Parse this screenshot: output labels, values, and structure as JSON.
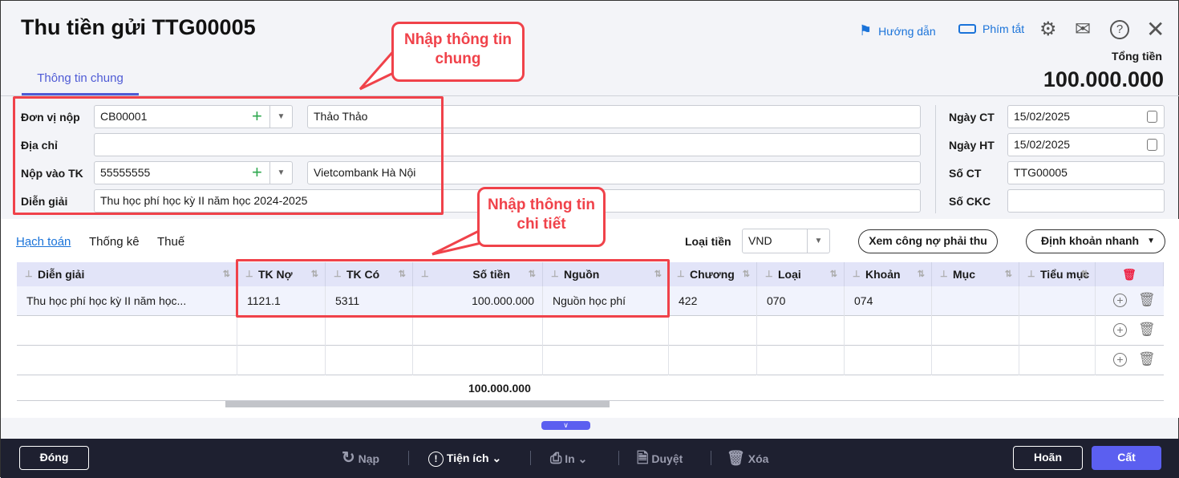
{
  "header": {
    "title": "Thu tiền gửi TTG00005",
    "guide_label": "Hướng dẫn",
    "shortcut_label": "Phím tắt",
    "total_label": "Tổng tiền",
    "total_value": "100.000.000"
  },
  "tabs": {
    "general": "Thông tin chung"
  },
  "callouts": {
    "general": "Nhập thông tin chung",
    "detail": "Nhập thông tin chi tiết"
  },
  "form": {
    "payer_label": "Đơn vị nộp",
    "payer_code": "CB00001",
    "payer_name": "Thảo Thảo",
    "address_label": "Địa chỉ",
    "address_value": "",
    "account_label": "Nộp vào TK",
    "account_code": "55555555",
    "account_name": "Vietcombank Hà Nội",
    "desc_label": "Diễn giải",
    "desc_value": "Thu học phí học kỳ II năm học 2024-2025",
    "date_ct_label": "Ngày CT",
    "date_ct": "15/02/2025",
    "date_ht_label": "Ngày HT",
    "date_ht": "15/02/2025",
    "so_ct_label": "Số CT",
    "so_ct": "TTG00005",
    "so_ckc_label": "Số CKC",
    "so_ckc": ""
  },
  "detail_tabs": [
    "Hạch toán",
    "Thống kê",
    "Thuế"
  ],
  "currency": {
    "label": "Loại tiền",
    "value": "VND"
  },
  "buttons": {
    "debt": "Xem công nợ phải thu",
    "quick": "Định khoản nhanh"
  },
  "table": {
    "columns": [
      "Diễn giải",
      "TK Nợ",
      "TK Có",
      "Số tiền",
      "Nguồn",
      "Chương",
      "Loại",
      "Khoản",
      "Mục",
      "Tiểu mục"
    ],
    "rows": [
      [
        "Thu học phí học kỳ II năm học...",
        "1121.1",
        "5311",
        "100.000.000",
        "Nguồn học phí",
        "422",
        "070",
        "074",
        "",
        ""
      ]
    ],
    "total": "100.000.000"
  },
  "footer": {
    "close": "Đóng",
    "reload": "Nạp",
    "utilities": "Tiện ích",
    "print": "In",
    "approve": "Duyệt",
    "delete": "Xóa",
    "cancel": "Hoãn",
    "save": "Cất"
  },
  "colors": {
    "accent": "#5b5ff0",
    "annotation": "#f0424a",
    "footer_bg": "#1e2030"
  }
}
